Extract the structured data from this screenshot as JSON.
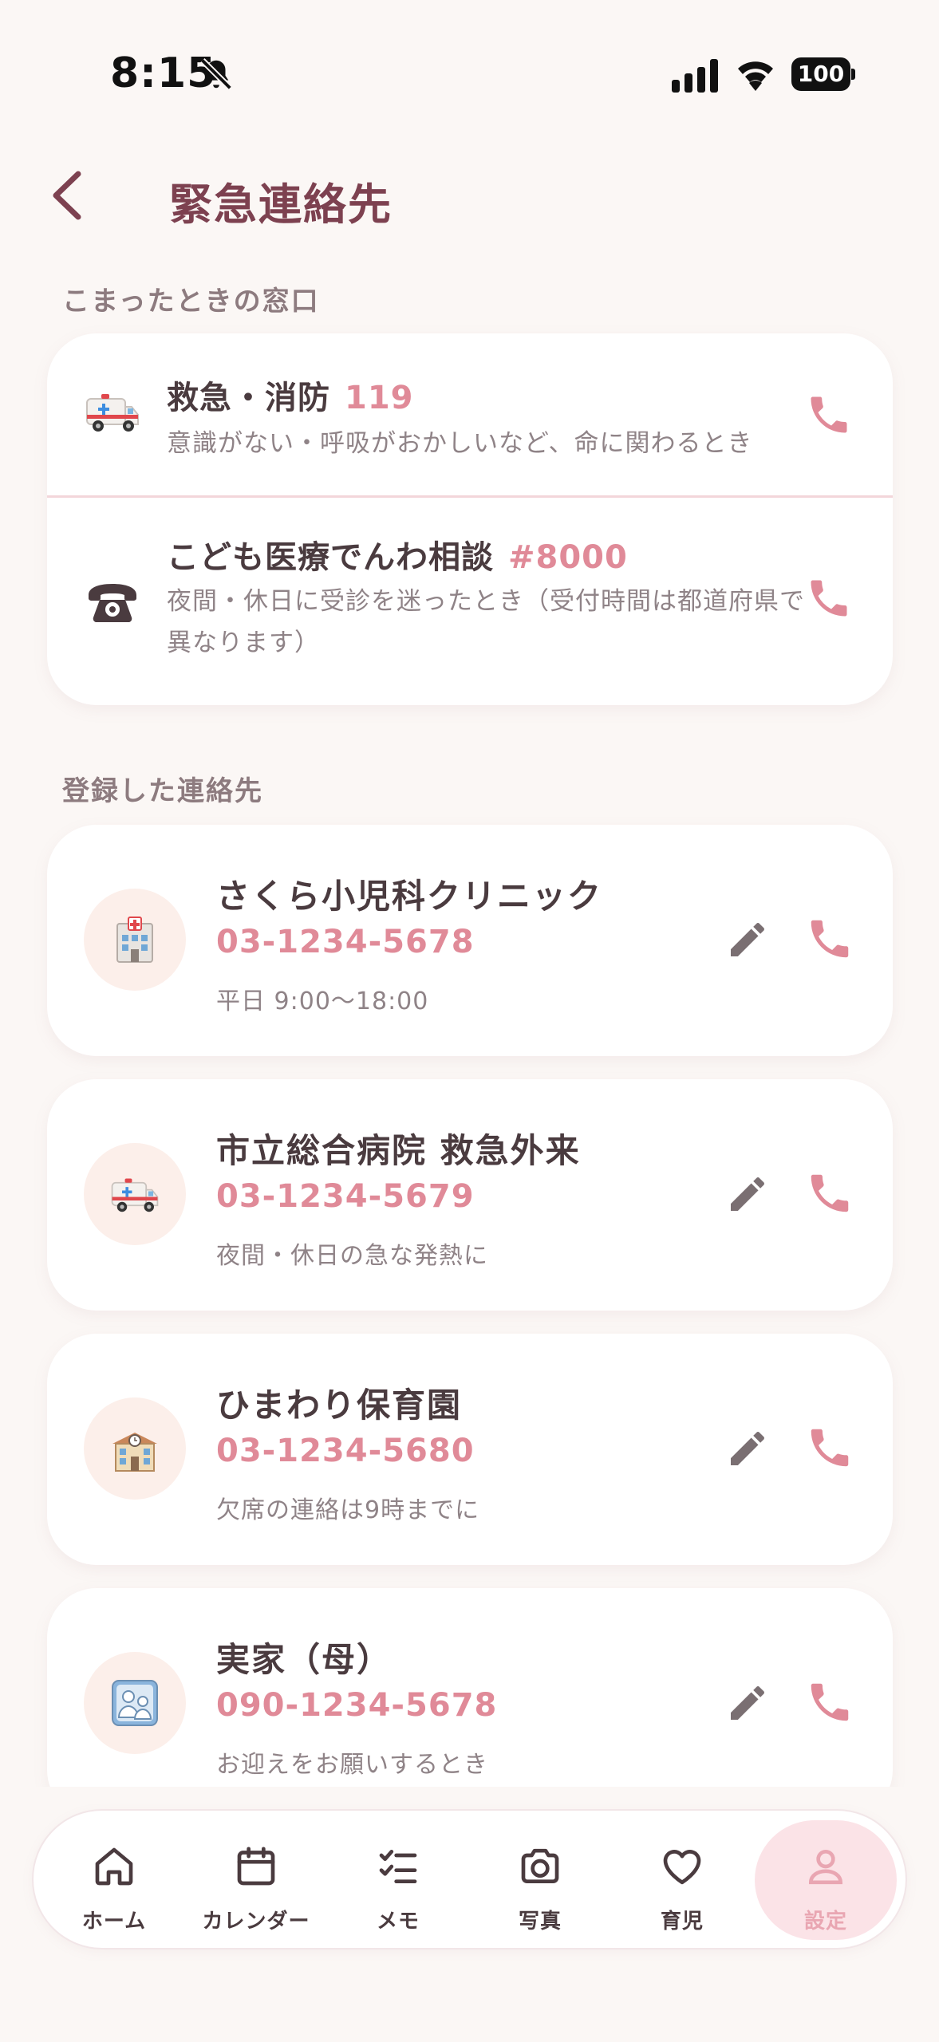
{
  "status_bar": {
    "time": "8:15",
    "battery": "100"
  },
  "header": {
    "title": "緊急連絡先"
  },
  "sections": {
    "hotlines_label": "こまったときの窓口",
    "contacts_label": "登録した連絡先"
  },
  "hotlines": [
    {
      "icon": "ambulance-icon",
      "name": "救急・消防",
      "number": "119",
      "description": "意識がない・呼吸がおかしいなど、命に関わるとき"
    },
    {
      "icon": "telephone-icon",
      "name": "こども医療でんわ相談",
      "number": "#8000",
      "description": "夜間・休日に受診を迷ったとき（受付時間は都道府県で異なります）"
    }
  ],
  "contacts": [
    {
      "icon": "hospital-icon",
      "name": "さくら小児科クリニック",
      "phone": "03-1234-5678",
      "note": "平日 9:00〜18:00"
    },
    {
      "icon": "ambulance-icon",
      "name": "市立総合病院 救急外来",
      "phone": "03-1234-5679",
      "note": "夜間・休日の急な発熱に"
    },
    {
      "icon": "school-icon",
      "name": "ひまわり保育園",
      "phone": "03-1234-5680",
      "note": "欠席の連絡は9時までに"
    },
    {
      "icon": "family-portrait-icon",
      "name": "実家（母）",
      "phone": "090-1234-5678",
      "note": "お迎えをお願いするとき"
    }
  ],
  "nav": [
    {
      "icon": "home-icon",
      "label": "ホーム"
    },
    {
      "icon": "calendar-icon",
      "label": "カレンダー"
    },
    {
      "icon": "checklist-icon",
      "label": "メモ"
    },
    {
      "icon": "camera-icon",
      "label": "写真"
    },
    {
      "icon": "heart-icon",
      "label": "育児"
    },
    {
      "icon": "person-icon",
      "label": "設定",
      "active": true
    }
  ],
  "colors": {
    "accent": "#e08a98",
    "title": "#7d4150",
    "background": "#fbf7f5",
    "active_nav_bg": "#fbe3e7"
  }
}
